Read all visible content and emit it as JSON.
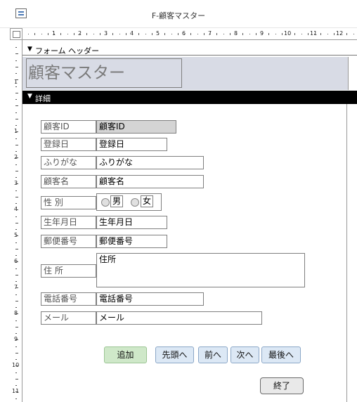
{
  "window": {
    "title": "F-顧客マスター"
  },
  "ruler": {
    "h_numbers": [
      "1",
      "2",
      "3",
      "4",
      "5",
      "6",
      "7",
      "8",
      "9",
      "10",
      "11",
      "12"
    ],
    "v_header_numbers": [
      "1"
    ],
    "v_detail_numbers": [
      "1",
      "2",
      "3",
      "4",
      "5",
      "6",
      "7",
      "8",
      "9",
      "10",
      "11"
    ]
  },
  "sections": {
    "header": "フォーム ヘッダー",
    "detail": "詳細"
  },
  "header": {
    "title": "顧客マスター"
  },
  "fields": [
    {
      "label": "顧客ID",
      "value": "顧客ID"
    },
    {
      "label": "登録日",
      "value": "登録日"
    },
    {
      "label": "ふりがな",
      "value": "ふりがな"
    },
    {
      "label": "顧客名",
      "value": "顧客名"
    },
    {
      "label": "性 別",
      "value": ""
    },
    {
      "label": "生年月日",
      "value": "生年月日"
    },
    {
      "label": "郵便番号",
      "value": "郵便番号"
    },
    {
      "label": "住 所",
      "value": "住所"
    },
    {
      "label": "電話番号",
      "value": "電話番号"
    },
    {
      "label": "メール",
      "value": "メール"
    }
  ],
  "gender": {
    "option1": "男",
    "option2": "女"
  },
  "buttons": {
    "add": "追加",
    "first": "先頭へ",
    "prev": "前へ",
    "next": "次へ",
    "last": "最後へ",
    "close": "終了"
  },
  "colors": {
    "header_bg": "#d8dbe5",
    "detail_bar": "#000000",
    "add_button": "#cfe8c9",
    "nav_button": "#dce8f5"
  }
}
